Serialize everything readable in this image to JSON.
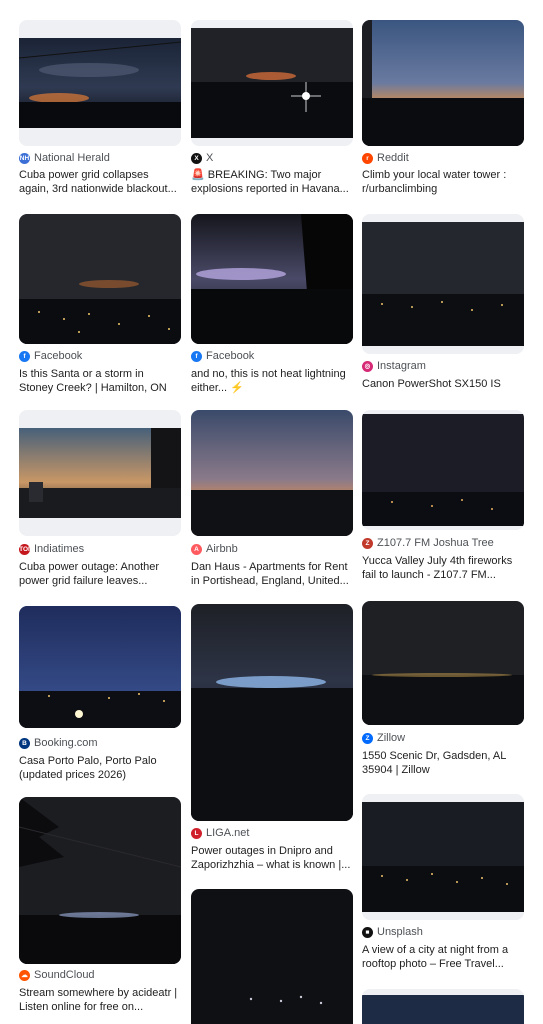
{
  "results": [
    {
      "source": "National Herald",
      "title": "Cuba power grid collapses again, 3rd nationwide blackout...",
      "favicon": "NH",
      "favicon_color": "#3b6fd6"
    },
    {
      "source": "X",
      "title": "🚨 BREAKING: Two major explosions reported in Havana...",
      "favicon": "X",
      "favicon_color": "#111111"
    },
    {
      "source": "Reddit",
      "title": "Climb your local water tower : r/urbanclimbing",
      "favicon": "r",
      "favicon_color": "#ff4500"
    },
    {
      "source": "Facebook",
      "title": "Is this Santa or a storm in Stoney Creek? | Hamilton, ON",
      "favicon": "f",
      "favicon_color": "#1877f2"
    },
    {
      "source": "Facebook",
      "title": "and no, this is not heat lightning either... ⚡",
      "favicon": "f",
      "favicon_color": "#1877f2"
    },
    {
      "source": "Instagram",
      "title": "Canon PowerShot SX150 IS",
      "favicon": "◎",
      "favicon_color": "#d62976"
    },
    {
      "source": "Indiatimes",
      "title": "Cuba power outage: Another power grid failure leaves...",
      "favicon": "TOI",
      "favicon_color": "#c4171d"
    },
    {
      "source": "Airbnb",
      "title": "Dan Haus - Apartments for Rent in Portishead, England, United...",
      "favicon": "A",
      "favicon_color": "#ff5a5f"
    },
    {
      "source": "Z107.7 FM Joshua Tree",
      "title": "Yucca Valley July 4th fireworks fail to launch - Z107.7 FM...",
      "favicon": "Z",
      "favicon_color": "#c0392b"
    },
    {
      "source": "Booking.com",
      "title": "Casa Porto Palo, Porto Palo (updated prices 2026)",
      "favicon": "B",
      "favicon_color": "#003580"
    },
    {
      "source": "LIGA.net",
      "title": "Power outages in Dnipro and Zaporizhzhia – what is known |...",
      "favicon": "L",
      "favicon_color": "#d0202b"
    },
    {
      "source": "Zillow",
      "title": "1550 Scenic Dr, Gadsden, AL 35904 | Zillow",
      "favicon": "Z",
      "favicon_color": "#006aff"
    },
    {
      "source": "SoundCloud",
      "title": "Stream somewhere by acideatr | Listen online for free on...",
      "favicon": "☁",
      "favicon_color": "#ff5500"
    },
    {
      "source": "Unsplash",
      "title": "A view of a city at night from a rooftop photo – Free Travel...",
      "favicon": "■",
      "favicon_color": "#111111"
    },
    {
      "source": "",
      "title": "",
      "favicon": "",
      "favicon_color": "#333333"
    },
    {
      "source": "",
      "title": "",
      "favicon": "",
      "favicon_color": "#333333"
    }
  ]
}
